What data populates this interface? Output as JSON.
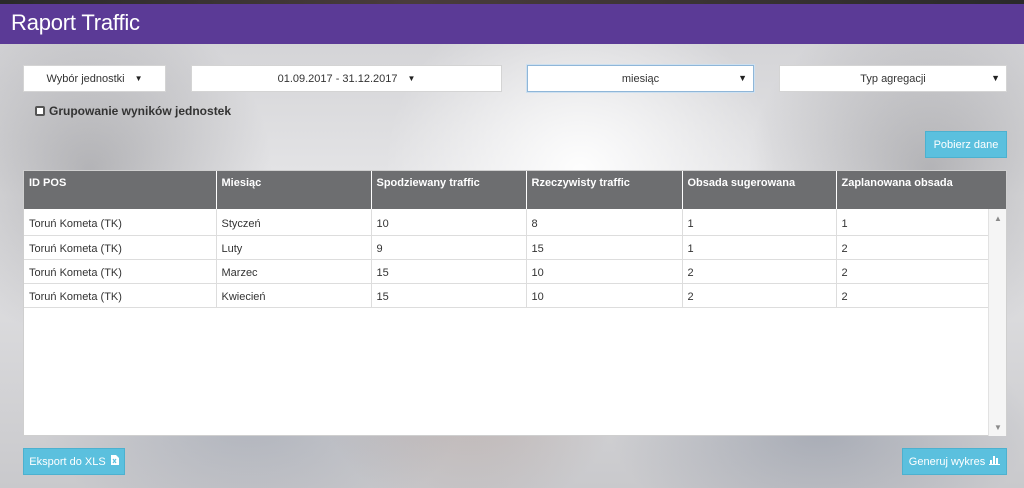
{
  "header": {
    "title": "Raport Traffic"
  },
  "filters": {
    "unit_select": "Wybór jednostki",
    "date_range": "01.09.2017 - 31.12.2017",
    "period_select": "miesiąc",
    "aggregation_select": "Typ agregacji",
    "group_checkbox": "Grupowanie wyników jednostek"
  },
  "actions": {
    "fetch": "Pobierz dane",
    "export": "Eksport do XLS",
    "chart": "Generuj wykres"
  },
  "table": {
    "columns": [
      "ID POS",
      "Miesiąc",
      "Spodziewany traffic",
      "Rzeczywisty traffic",
      "Obsada sugerowana",
      "Zaplanowana obsada"
    ],
    "rows": [
      [
        "Toruń Kometa (TK)",
        "Styczeń",
        "10",
        "8",
        "1",
        "1"
      ],
      [
        "Toruń Kometa (TK)",
        "Luty",
        "9",
        "15",
        "1",
        "2"
      ],
      [
        "Toruń Kometa (TK)",
        "Marzec",
        "15",
        "10",
        "2",
        "2"
      ],
      [
        "Toruń Kometa (TK)",
        "Kwiecień",
        "15",
        "10",
        "2",
        "2"
      ]
    ]
  },
  "colors": {
    "header_bg": "#5b3a96",
    "button_bg": "#5bc0de",
    "table_header_bg": "#6d6e70"
  }
}
